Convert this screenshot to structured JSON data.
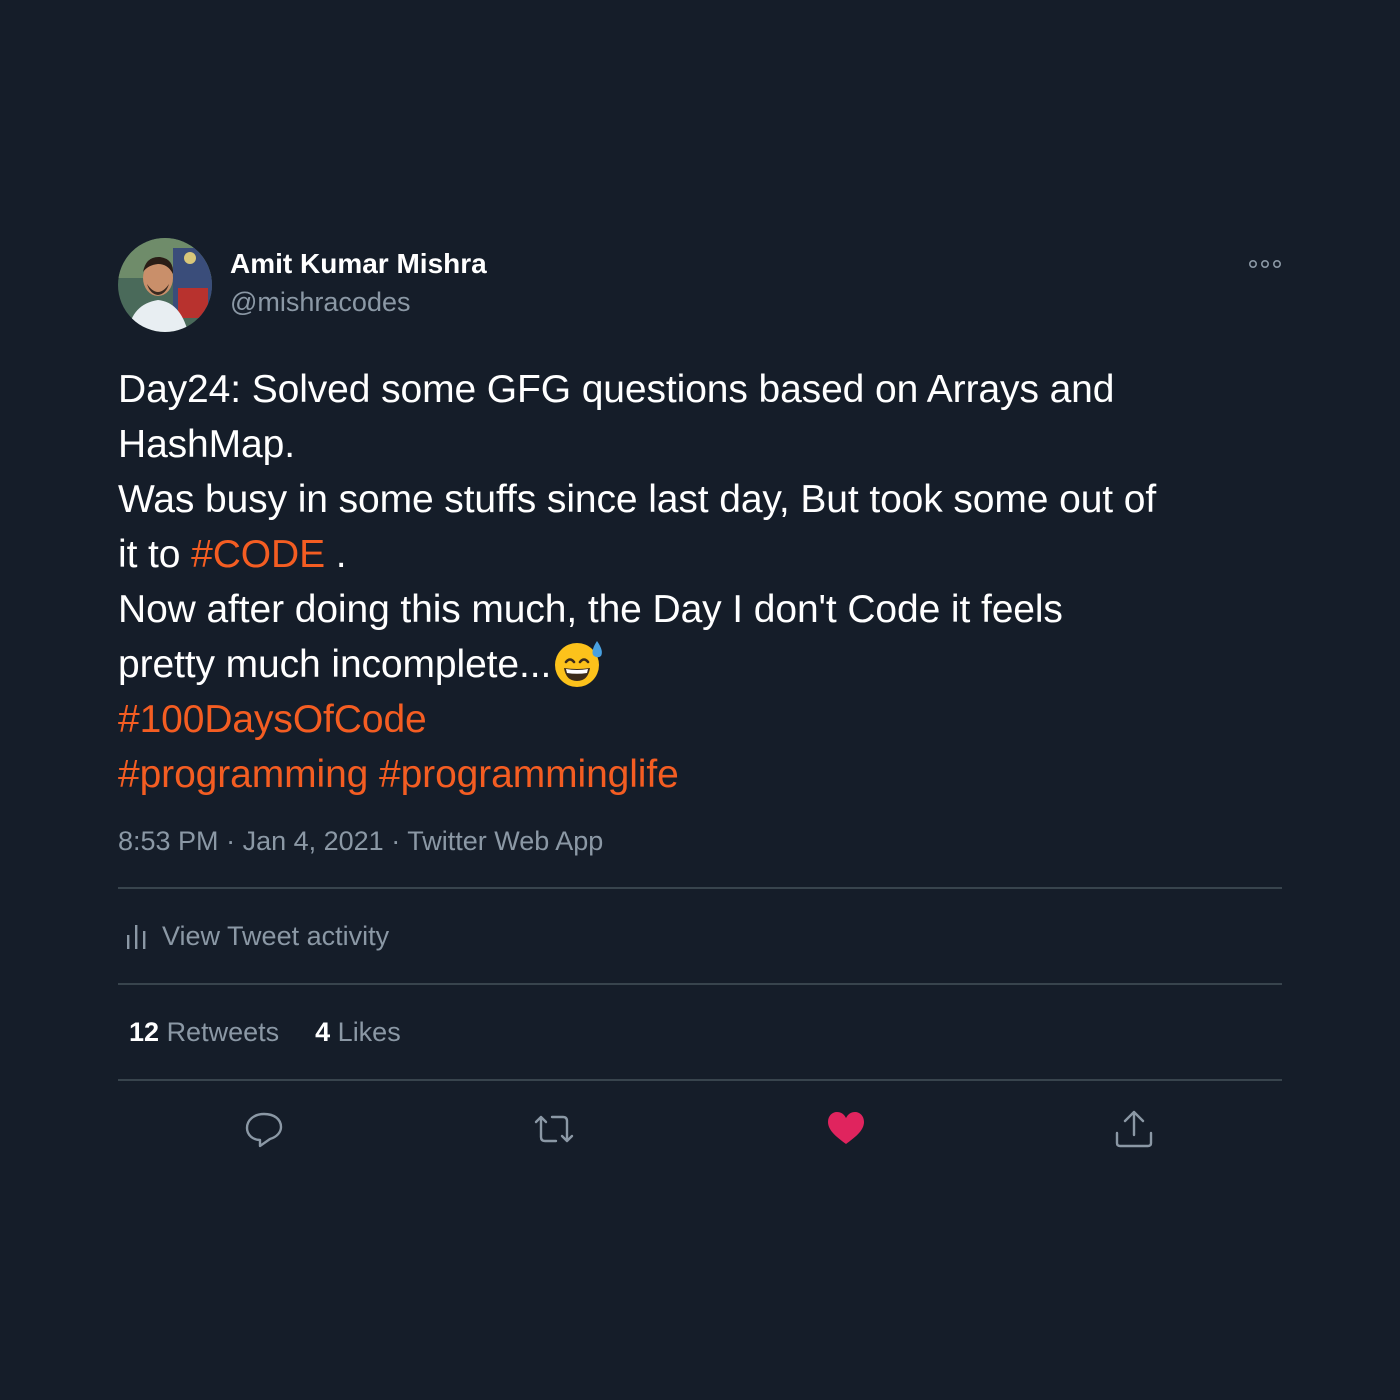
{
  "author": {
    "display_name": "Amit Kumar Mishra",
    "handle": "@mishracodes"
  },
  "tweet": {
    "lines": [
      [
        {
          "text": "Day24: Solved some GFG questions based on Arrays and",
          "type": "text"
        }
      ],
      [
        {
          "text": "HashMap.",
          "type": "text"
        }
      ],
      [
        {
          "text": "Was busy in some stuffs since last day, But took some out of",
          "type": "text"
        }
      ],
      [
        {
          "text": "it to ",
          "type": "text"
        },
        {
          "text": "#CODE",
          "type": "hashtag"
        },
        {
          "text": " .",
          "type": "text"
        }
      ],
      [
        {
          "text": "Now after doing this much, the Day I don't Code it feels",
          "type": "text"
        }
      ],
      [
        {
          "text": "pretty much incomplete...",
          "type": "text"
        }
      ],
      [
        {
          "text": "#100DaysOfCode",
          "type": "hashtag"
        }
      ],
      [
        {
          "text": "#programming",
          "type": "hashtag"
        },
        {
          "text": " ",
          "type": "text"
        },
        {
          "text": "#programminglife",
          "type": "hashtag"
        }
      ]
    ],
    "emoji": "grinning-face-with-sweat",
    "time": "8:53 PM",
    "date": "Jan 4, 2021",
    "source": "Twitter Web App"
  },
  "activity_label": "View Tweet activity",
  "stats": {
    "retweets_count": "12",
    "retweets_label": "Retweets",
    "likes_count": "4",
    "likes_label": "Likes"
  },
  "icons": {
    "more": "more-options-icon",
    "activity": "bar-chart-icon",
    "reply": "reply-icon",
    "retweet": "retweet-icon",
    "like": "heart-icon",
    "share": "share-icon"
  },
  "colors": {
    "background": "#151d29",
    "hashtag": "#f45d22",
    "muted": "#8b98a5",
    "divider": "#38444d",
    "liked": "#e0245e"
  },
  "state": {
    "liked": true
  }
}
